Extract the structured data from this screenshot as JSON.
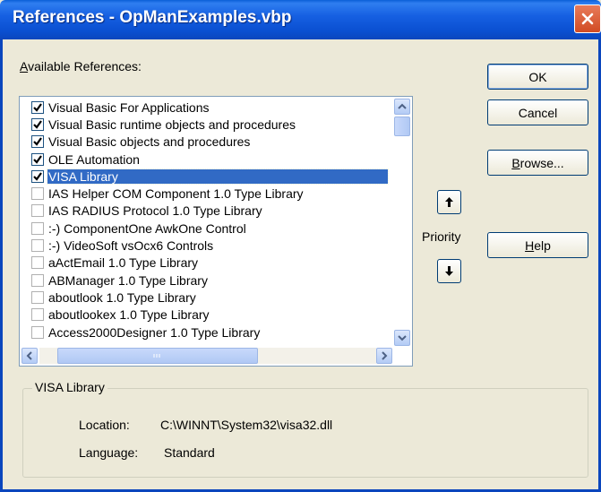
{
  "window": {
    "title": "References - OpManExamples.vbp",
    "close_icon": "close-x-icon"
  },
  "available_label_prefix": "A",
  "available_label_rest": "vailable References:",
  "references": [
    {
      "label": "Visual Basic For Applications",
      "checked": true,
      "selected": false
    },
    {
      "label": "Visual Basic runtime objects and procedures",
      "checked": true,
      "selected": false
    },
    {
      "label": "Visual Basic objects and procedures",
      "checked": true,
      "selected": false
    },
    {
      "label": "OLE Automation",
      "checked": true,
      "selected": false
    },
    {
      "label": "VISA Library",
      "checked": true,
      "selected": true
    },
    {
      "label": "IAS Helper COM Component 1.0 Type Library",
      "checked": false,
      "selected": false
    },
    {
      "label": "IAS RADIUS Protocol 1.0 Type Library",
      "checked": false,
      "selected": false
    },
    {
      "label": ":-) ComponentOne AwkOne Control",
      "checked": false,
      "selected": false
    },
    {
      "label": ":-) VideoSoft vsOcx6 Controls",
      "checked": false,
      "selected": false
    },
    {
      "label": "aActEmail 1.0 Type Library",
      "checked": false,
      "selected": false
    },
    {
      "label": "ABManager 1.0 Type Library",
      "checked": false,
      "selected": false
    },
    {
      "label": "aboutlook 1.0 Type Library",
      "checked": false,
      "selected": false
    },
    {
      "label": "aboutlookex 1.0 Type Library",
      "checked": false,
      "selected": false
    },
    {
      "label": "Access2000Designer 1.0 Type Library",
      "checked": false,
      "selected": false
    }
  ],
  "buttons": {
    "ok": "OK",
    "cancel": "Cancel",
    "browse_prefix": "B",
    "browse_rest": "rowse...",
    "help_prefix": "H",
    "help_rest": "elp"
  },
  "priority": {
    "label": "Priority",
    "up_icon": "arrow-up-icon",
    "down_icon": "arrow-down-icon"
  },
  "details": {
    "group_title": "VISA Library",
    "location_label": "Location:",
    "location_value": "C:\\WINNT\\System32\\visa32.dll",
    "language_label": "Language:",
    "language_value": "Standard"
  },
  "colors": {
    "title_blue": "#0b46bd",
    "selection": "#316ac5",
    "dialog_bg": "#ece9d8",
    "close_red": "#d14b23"
  }
}
